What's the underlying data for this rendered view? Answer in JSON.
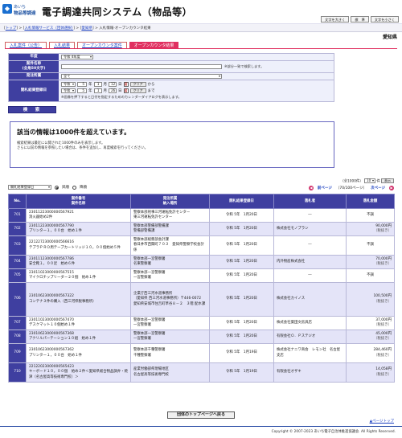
{
  "header": {
    "logo_line1": "あいち",
    "logo_line2": "物品等調達",
    "title": "電子調達共同システム（物品等）",
    "font_buttons": [
      "文字を大きく",
      "標　準",
      "文字を小さく"
    ]
  },
  "breadcrumb": {
    "items": [
      "トップ",
      "入札情報サービス（団体選択）",
      "愛知県",
      "入札情報-オープンカウンタ結果"
    ]
  },
  "region": "愛知県",
  "tabs": [
    "入札案件（公告）",
    "入札結果",
    "オープンカウンタ案件",
    "オープンカウンタ結果"
  ],
  "search": {
    "year_label": "年度",
    "year_value": "令和 4年度",
    "name_label_line1": "案件名称",
    "name_label_line2": "(全角50文字)",
    "name_note": "※部分一致で検索します。",
    "org_label": "発注所属",
    "org_value": "全て",
    "date_label": "開札結果登録日",
    "era": "令和",
    "from": {
      "y": "5",
      "m": "1",
      "d": "12"
    },
    "to": {
      "y": "5",
      "m": "1",
      "d": "26"
    },
    "unit_y": "年",
    "unit_m": "月",
    "unit_d": "日",
    "cal": "暦",
    "clear": "クリア",
    "from_suffix": "から",
    "to_suffix": "まで",
    "date_note": "※画像を押下すると日付を指定するためのカレンダーダイアログを表示します。",
    "button": "検　索"
  },
  "notice": {
    "title": "該当の情報は1000件を超えています。",
    "line1": "検索結果は最近に公開された1000件のみを表示します。",
    "line2": "さらに以前の情報を参照したい場合は、条件を追加し、再度検索を行ってください。"
  },
  "pager": {
    "count_text": "（全1000件）",
    "per_page": "10",
    "per_page_unit": "件",
    "show": "表示",
    "sort_field": "開札結果登録日",
    "asc": "昇順",
    "desc": "降順",
    "prev": "前ページ",
    "page_info": "（70/100ページ）",
    "next": "次ページ"
  },
  "table": {
    "headers": {
      "no": "No.",
      "case_line1": "案件番号",
      "case_line2": "案件名称",
      "org_line1": "発注所属",
      "org_line2": "納入場所",
      "date": "開札結果登録日",
      "winner": "落札者",
      "amount": "落札金額"
    },
    "rows": [
      {
        "no": "701",
        "case_id": "23011223000000567921",
        "case_name": "消火器始め2件",
        "org": "警察本部刑事三河運転免許センター",
        "place": "東三河運転免許センター",
        "date": "令和 5年　1月20日",
        "winner": "―",
        "amount": "不調",
        "tax": ""
      },
      {
        "no": "702",
        "case_id": "23011223000000567790",
        "case_name": "プリンター１，００台　始め１件",
        "org": "警察本部警備部警備課",
        "place": "警備部警備課",
        "date": "令和 5年　1月20日",
        "winner": "株式会社モノプラン",
        "amount": "90,000円",
        "tax": "（税抜き）"
      },
      {
        "no": "703",
        "case_id": "22122723000000566616",
        "case_name": "テプラＰＲＯ用テープカートリッジ１０，００個始め５件",
        "org": "警察本部総務部会計課",
        "place": "春日井市西関町７０３　愛知県警察学校会計係",
        "date": "令和 5年　1月20日",
        "winner": "―",
        "amount": "不調",
        "tax": ""
      },
      {
        "no": "704",
        "case_id": "23011123000000567786",
        "case_name": "安全靴１，００足　始め６件",
        "org": "警察本部一宮警察署",
        "place": "名東警察署",
        "date": "令和 5年　1月20日",
        "winner": "内外物産株式会社",
        "amount": "70,000円",
        "tax": "（税抜き）"
      },
      {
        "no": "705",
        "case_id": "23011023000000567515",
        "case_name": "マイクロチップリーダー２０個　始め１件",
        "org": "警察本部一宮警察署",
        "place": "一宮警察署",
        "date": "令和 5年　1月20日",
        "winner": "―",
        "amount": "不調",
        "tax": ""
      },
      {
        "no": "706",
        "case_id": "23010623000000567322",
        "case_name": "コンテナ３件の購入（西三河県税事務所）",
        "org": "企業庁西三河水道事務所",
        "place": "（愛知県 西三河水道事務所）〒446-0072　愛知県安城市住吉町草谷８－２　３階 配水課",
        "date": "令和 5年　1月20日",
        "winner": "株式会社カイノス",
        "amount": "100,500円",
        "tax": "（税抜き）"
      },
      {
        "no": "707",
        "case_id": "23011023000000567470",
        "case_name": "デスクマット１０個始め１件",
        "org": "警察本部一宮警察署",
        "place": "一宮警察署",
        "date": "令和 5年　1月20日",
        "winner": "株式会社葉田文房具店",
        "amount": "37,000円",
        "tax": "（税抜き）"
      },
      {
        "no": "708",
        "case_id": "23010623000000567368",
        "case_name": "アクリルパーテーション１０組　始め１件",
        "org": "警察本部一宮警察署",
        "place": "一宮警察署",
        "date": "令和 5年　1月20日",
        "winner": "有限会社Ｏ．Ｐステジオ",
        "amount": "45,000円",
        "tax": "（税抜き）"
      },
      {
        "no": "709",
        "case_id": "23010623000000567362",
        "case_name": "プリンター１，００台　始め１件",
        "org": "警察本部千種警察署",
        "place": "千種警察署",
        "date": "令和 5年　1月19日",
        "winner": "株式会社ナニワ商会　レモン社　名古屋支店",
        "amount": "284,460円",
        "tax": "（税抜き）"
      },
      {
        "no": "710",
        "case_id": "22122023000000565423",
        "case_name": "キーボード１０，００個　始め２件＜愛知県総合物品調弁・焼津（名古屋高等技術専門校）＞",
        "org": "産業労働部県現場地区",
        "place": "名古屋高等技術専門校",
        "date": "令和 5年　1月19日",
        "winner": "有限会社オザキ",
        "amount": "14,058円",
        "tax": "（税抜き）"
      }
    ]
  },
  "back_button": "団体のトップページへ戻る",
  "pagetop": "▲ページトップ",
  "footer": "Copyright © 2007-2023 あいち電子自治体推進協議会. All Rights Reserved."
}
